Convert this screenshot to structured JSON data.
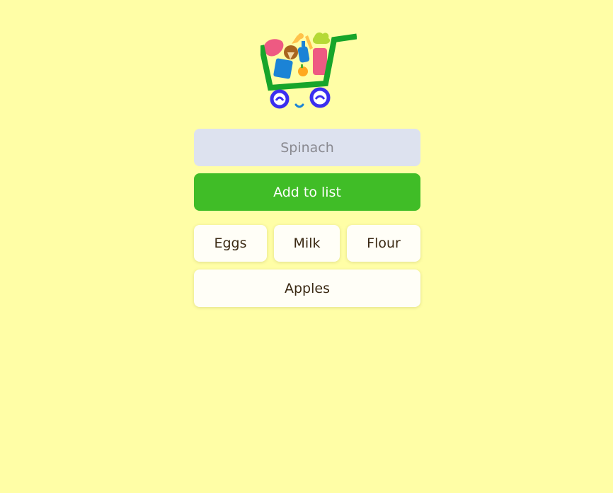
{
  "colors": {
    "background": "#fffea6",
    "input_bg": "#dde2ef",
    "button_bg": "#40bd27",
    "item_bg": "#fffef7",
    "item_text": "#3b2a14"
  },
  "logo": {
    "icon": "shopping-cart-logo"
  },
  "input": {
    "placeholder": "Spinach",
    "value": ""
  },
  "add_button": {
    "label": "Add to list"
  },
  "items": [
    {
      "label": "Eggs"
    },
    {
      "label": "Milk"
    },
    {
      "label": "Flour"
    },
    {
      "label": "Apples"
    }
  ]
}
